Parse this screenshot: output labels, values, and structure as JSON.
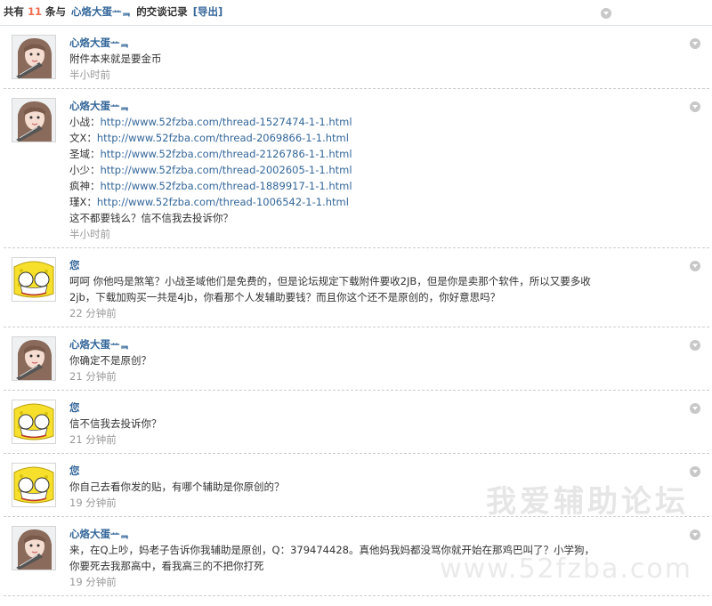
{
  "header": {
    "prefix": "共有",
    "count": "11",
    "middle": "条与",
    "partner": "心烙大蛋ᅭᆿ",
    "suffix": "的交谈记录",
    "export_label": "[导出]"
  },
  "messages": [
    {
      "author": "心烙大蛋ᅭᆿ",
      "avatar": "girl-avatar",
      "lines": [
        "附件本来就是要金币"
      ],
      "time": "半小时前"
    },
    {
      "author": "心烙大蛋ᅭᆿ",
      "avatar": "girl-avatar",
      "links": [
        {
          "label": "小战：",
          "url": "http://www.52fzba.com/thread-1527474-1-1.html"
        },
        {
          "label": "文X：",
          "url": "http://www.52fzba.com/thread-2069866-1-1.html"
        },
        {
          "label": "圣域：",
          "url": "http://www.52fzba.com/thread-2126786-1-1.html"
        },
        {
          "label": "小少：",
          "url": "http://www.52fzba.com/thread-2002605-1-1.html"
        },
        {
          "label": "疯神：",
          "url": "http://www.52fzba.com/thread-1889917-1-1.html"
        },
        {
          "label": "瑾X：",
          "url": "http://www.52fzba.com/thread-1006542-1-1.html"
        }
      ],
      "lines": [
        "这不都要钱么？信不信我去投诉你？"
      ],
      "time": "半小时前"
    },
    {
      "author": "您",
      "avatar": "sponge-avatar",
      "lines": [
        "呵呵  你他吗是煞笔？小战圣域他们是免费的，但是论坛规定下载附件要收2JB，但是你是卖那个软件，所以又要多收",
        "2jb，下载加购买一共是4jb，你看那个人发辅助要钱？而且你这个还不是原创的，你好意思吗？"
      ],
      "time": "22 分钟前"
    },
    {
      "author": "心烙大蛋ᅭᆿ",
      "avatar": "girl-avatar",
      "lines": [
        "你确定不是原创？"
      ],
      "time": "21 分钟前"
    },
    {
      "author": "您",
      "avatar": "sponge-avatar",
      "lines": [
        "信不信我去投诉你？"
      ],
      "time": "21 分钟前"
    },
    {
      "author": "您",
      "avatar": "sponge-avatar",
      "lines": [
        "你自己去看你发的贴，有哪个辅助是你原创的？"
      ],
      "time": "19 分钟前"
    },
    {
      "author": "心烙大蛋ᅭᆿ",
      "avatar": "girl-avatar",
      "lines": [
        "来，在Q上吵，妈老子告诉你我辅助是原创，Q：379474428。真他妈我妈都没骂你就开始在那鸡巴叫了？小学狗，",
        "你要死去我那高中，看我高三的不把你打死"
      ],
      "time": "19 分钟前"
    }
  ],
  "watermark": {
    "title": "我爱辅助论坛",
    "url": "www.52fzba.com"
  },
  "colors": {
    "link": "#336699",
    "count": "#f26c4f",
    "time": "#999999"
  }
}
